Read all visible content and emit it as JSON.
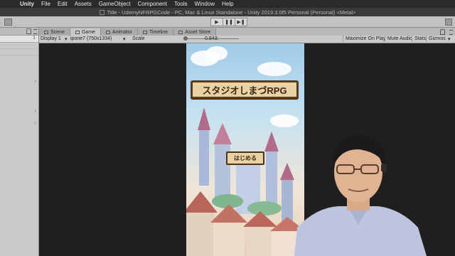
{
  "menubar": {
    "apple_icon": "apple-icon",
    "items": [
      "Unity",
      "File",
      "Edit",
      "Assets",
      "GameObject",
      "Component",
      "Tools",
      "Window",
      "Help"
    ]
  },
  "window": {
    "title": "Title - UdemyNFRPGCode - PC, Mac & Linux Standalone - Unity 2019.3.0f5 Personal (Personal) <Metal>"
  },
  "toolbar": {
    "play_buttons": [
      "▶",
      "❚❚",
      "▶❚"
    ]
  },
  "hierarchy": {
    "count": "1"
  },
  "tabs": [
    {
      "label": "Scene",
      "icon": "scene-icon",
      "active": false
    },
    {
      "label": "Game",
      "icon": "game-icon",
      "active": true
    },
    {
      "label": "Animator",
      "icon": "animator-icon",
      "active": false
    },
    {
      "label": "Timeline",
      "icon": "timeline-icon",
      "active": false
    },
    {
      "label": "Asset Store",
      "icon": "asset-store-icon",
      "active": false
    }
  ],
  "game_bar": {
    "display": "Display 1",
    "resolution": "ipone7 (750x1334)",
    "scale_label": "Scale",
    "scale_value": "0.843:",
    "buttons": [
      "Maximize On Play",
      "Mute Audio",
      "Stats",
      "Gizmos"
    ]
  },
  "game": {
    "title": "スタジオしまづRPG",
    "start_button": "はじめる"
  },
  "colors": {
    "plate_bg": "#e7d2a3",
    "plate_border": "#5b3a1d",
    "editor_bg": "#c2c2c2"
  }
}
